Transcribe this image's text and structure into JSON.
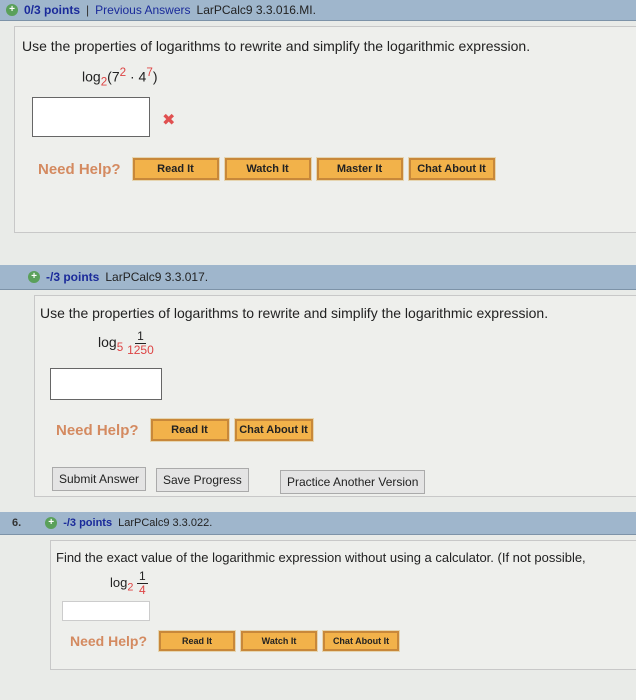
{
  "q1": {
    "points": "0/3 points",
    "separator": "|",
    "previous": "Previous Answers",
    "code": "LarPCalc9 3.3.016.MI.",
    "question": "Use the properties of logarithms to rewrite and simplify the logarithmic expression.",
    "expr_log": "log",
    "expr_base": "2",
    "expr_open": "(7",
    "expr_exp1": "2",
    "expr_mid": " · 4",
    "expr_exp2": "7",
    "expr_close": ")",
    "wrong_mark": "✖",
    "need_help": "Need Help?",
    "buttons": [
      "Read It",
      "Watch It",
      "Master It",
      "Chat About It"
    ]
  },
  "q2": {
    "points": "-/3 points",
    "code": "LarPCalc9 3.3.017.",
    "question": "Use the properties of logarithms to rewrite and simplify the logarithmic expression.",
    "expr_log": "log",
    "expr_base": "5",
    "num": "1",
    "den": "1250",
    "need_help": "Need Help?",
    "buttons": [
      "Read It",
      "Chat About It"
    ],
    "submit": "Submit Answer",
    "save": "Save Progress",
    "practice": "Practice Another Version"
  },
  "q3": {
    "number": "6.",
    "points": "-/3 points",
    "code": "LarPCalc9 3.3.022.",
    "question": "Find the exact value of the logarithmic expression without using a calculator. (If not possible,",
    "expr_log": "log",
    "expr_base": "2",
    "num": "1",
    "den": "4",
    "need_help": "Need Help?",
    "buttons": [
      "Read It",
      "Watch It",
      "Chat About It"
    ]
  }
}
